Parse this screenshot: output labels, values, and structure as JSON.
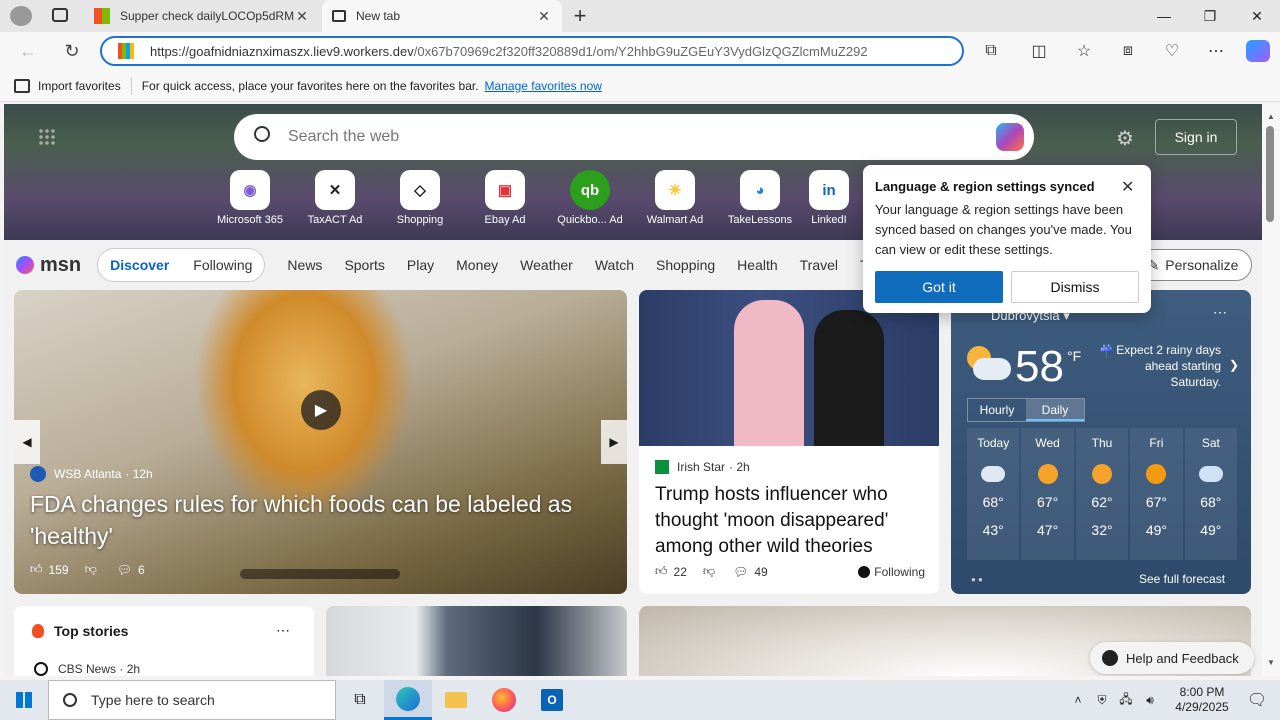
{
  "browser": {
    "tabs": [
      {
        "title": "Supper check dailyLOCOp5dRMI",
        "active": false
      },
      {
        "title": "New tab",
        "active": true
      }
    ],
    "new_tab_label": "+",
    "address": {
      "host": "https://goafnidniaznximaszx.liev9.workers.dev",
      "path": "/0x67b70969c2f320ff320889d1/om/Y2hhbG9uZGEuY3VydGlzQGZlcmMuZ292"
    },
    "favbar": {
      "import_label": "Import favorites",
      "hint": "For quick access, place your favorites here on the favorites bar.",
      "manage_link": "Manage favorites now"
    }
  },
  "newtab": {
    "search_placeholder": "Search the web",
    "sign_in": "Sign in",
    "quick_links": [
      {
        "label": "Microsoft 365",
        "ad": ""
      },
      {
        "label": "TaxACT",
        "ad": "Ad"
      },
      {
        "label": "Shopping",
        "ad": ""
      },
      {
        "label": "Ebay",
        "ad": "Ad"
      },
      {
        "label": "Quickbo...",
        "ad": "Ad"
      },
      {
        "label": "Walmart",
        "ad": "Ad"
      },
      {
        "label": "TakeLessons",
        "ad": ""
      },
      {
        "label": "LinkedI",
        "ad": ""
      }
    ],
    "brand": "msn",
    "nav": {
      "discover": "Discover",
      "following": "Following",
      "items": [
        "News",
        "Sports",
        "Play",
        "Money",
        "Weather",
        "Watch",
        "Shopping",
        "Health",
        "Travel",
        "T"
      ],
      "personalize": "Personalize"
    },
    "popup": {
      "title": "Language & region settings synced",
      "body": "Your language & region settings have been synced based on changes you've made. You can view or edit these settings.",
      "got_it": "Got it",
      "dismiss": "Dismiss"
    },
    "main_story": {
      "source": "WSB Atlanta",
      "age": "· 12h",
      "headline": "FDA changes rules for which foods can be labeled as 'healthy'",
      "likes": "159",
      "comments": "6"
    },
    "side_story": {
      "source": "Irish Star",
      "age": "· 2h",
      "headline": "Trump hosts influencer who thought 'moon disappeared' among other wild theories",
      "likes": "22",
      "comments": "49",
      "following": "Following"
    },
    "weather": {
      "location": "Dubrovytsia",
      "temp": "58",
      "unit": "°F",
      "note": "Expect 2 rainy days ahead starting Saturday.",
      "tabs": [
        "Hourly",
        "Daily"
      ],
      "days": [
        {
          "day": "Today",
          "hi": "68°",
          "lo": "43°",
          "icon": "partly-cloudy-icon"
        },
        {
          "day": "Wed",
          "hi": "67°",
          "lo": "47°",
          "icon": "partly-sunny-icon"
        },
        {
          "day": "Thu",
          "hi": "62°",
          "lo": "32°",
          "icon": "partly-sunny-icon"
        },
        {
          "day": "Fri",
          "hi": "67°",
          "lo": "49°",
          "icon": "sunny-icon"
        },
        {
          "day": "Sat",
          "hi": "68°",
          "lo": "49°",
          "icon": "rain-icon"
        }
      ],
      "full_forecast": "See full forecast"
    },
    "top_stories": {
      "title": "Top stories",
      "first_source": "CBS News",
      "first_age": "· 2h"
    },
    "help": "Help and Feedback"
  },
  "taskbar": {
    "search_placeholder": "Type here to search",
    "time": "8:00 PM",
    "date": "4/29/2025"
  }
}
